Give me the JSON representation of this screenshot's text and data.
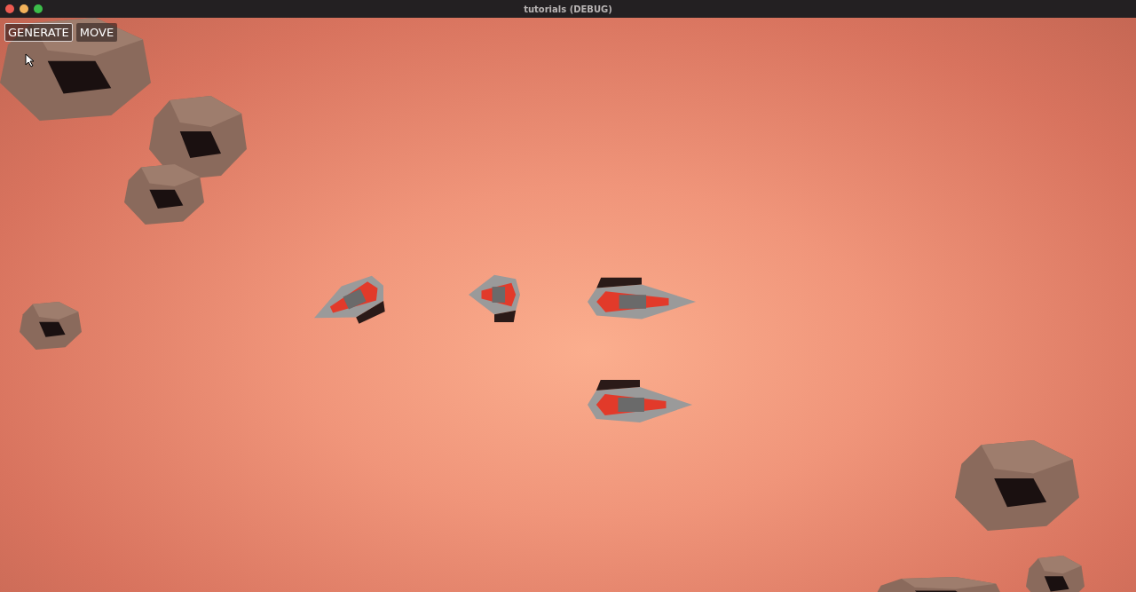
{
  "window": {
    "title": "tutorials (DEBUG)"
  },
  "buttons": [
    {
      "label": "GENERATE",
      "selected": true
    },
    {
      "label": "MOVE",
      "selected": false
    }
  ]
}
